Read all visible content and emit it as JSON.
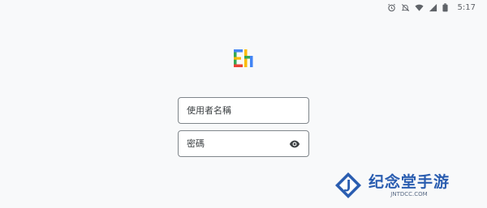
{
  "status_bar": {
    "time": "5:17",
    "icons": [
      "alarm-icon",
      "silent-icon",
      "wifi-icon",
      "signal-icon",
      "battery-icon"
    ]
  },
  "app": {
    "logo": "Eh",
    "logo_colors": [
      "#34a853",
      "#fbbc04",
      "#ea4335",
      "#4285f4"
    ]
  },
  "login": {
    "username_placeholder": "使用者名稱",
    "password_placeholder": "密碼",
    "password_toggle_icon": "eye-icon"
  },
  "watermark": {
    "title": "纪念堂手游",
    "subtitle": "JNTDCC.COM",
    "color": "#2a5db0"
  }
}
